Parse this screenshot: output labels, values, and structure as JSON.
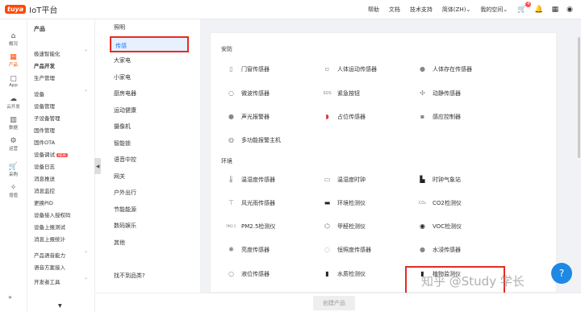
{
  "header": {
    "logo_badge": "tuya",
    "logo_text": "IoT平台",
    "nav": [
      "帮助",
      "文档",
      "技术支持",
      "简体(ZH)⌄",
      "我的空间⌄"
    ],
    "cart_count": "4"
  },
  "rail": [
    {
      "icon": "⌂",
      "label": "概况"
    },
    {
      "icon": "▦",
      "label": "产品"
    },
    {
      "icon": "▢",
      "label": "App"
    },
    {
      "icon": "☁",
      "label": "云开发"
    },
    {
      "icon": "▥",
      "label": "数据"
    },
    {
      "icon": "⚙",
      "label": "运营"
    },
    {
      "icon": "🛒",
      "label": "采购"
    },
    {
      "icon": "✧",
      "label": "增值"
    }
  ],
  "sidebar": {
    "title": "产品",
    "group1": "极速智能化",
    "group1_items": [
      "产品开发",
      "生产管理"
    ],
    "group2": "设备",
    "group2_items": [
      "设备管理",
      "子设备管理",
      "固件管理",
      "固件OTA",
      "设备调试",
      "设备日志",
      "消息推送",
      "消息监控",
      "更换PID",
      "设备接入授权码",
      "设备上报测试",
      "消息上报统计"
    ],
    "new_badge": "NEW",
    "group3": "产品语音能力",
    "group3_items": [
      "语音方案接入"
    ],
    "group4": "开发者工具"
  },
  "categories": [
    "照明",
    "传感",
    "大家电",
    "小家电",
    "厨房电器",
    "运动健康",
    "摄像机",
    "智能锁",
    "语音中控",
    "网关",
    "户外出行",
    "节能能源",
    "数码娱乐",
    "其他"
  ],
  "category_footer": "找不到品类?",
  "sections": {
    "security": "安防",
    "environment": "环境"
  },
  "security_devices": [
    [
      "门窗传感器",
      "人体运动传感器",
      "人体存在传感器"
    ],
    [
      "微波传感器",
      "紧急按钮",
      "动静传感器"
    ],
    [
      "声光报警器",
      "占位传感器",
      "感应控制器"
    ],
    [
      "多功能报警主机"
    ]
  ],
  "environment_devices": [
    [
      "温湿度传感器",
      "温湿度时钟",
      "时钟气象站"
    ],
    [
      "风光雨传感器",
      "环境检测仪",
      "CO2检测仪"
    ],
    [
      "PM2.5检测仪",
      "甲醛检测仪",
      "VOC检测仪"
    ],
    [
      "亮度传感器",
      "恒照度传感器",
      "水浸传感器"
    ],
    [
      "液位传感器",
      "水质检测仪",
      "植物监测仪"
    ]
  ],
  "bottom": {
    "create_label": "创建产品"
  },
  "watermark": "知乎 @Study 学长",
  "colors": {
    "brand": "#ff4800",
    "highlight": "#e62b21",
    "link": "#1677ff"
  }
}
